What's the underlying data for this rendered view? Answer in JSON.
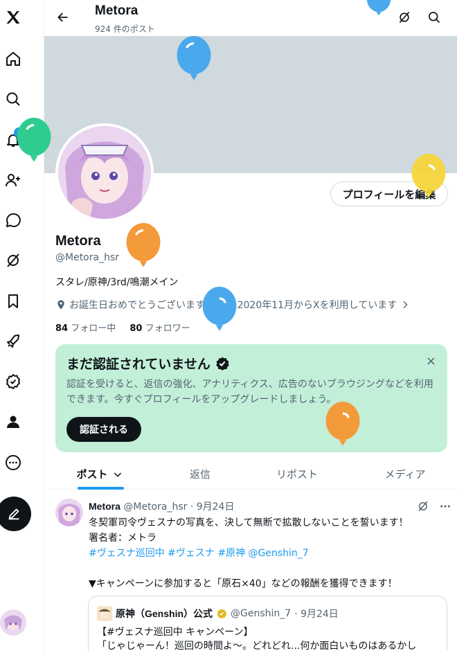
{
  "sidebar": {
    "notification_count": "1",
    "items": [
      {
        "name": "x-logo-icon"
      },
      {
        "name": "home-icon"
      },
      {
        "name": "search-icon"
      },
      {
        "name": "bell-icon"
      },
      {
        "name": "add-user-icon"
      },
      {
        "name": "messages-icon"
      },
      {
        "name": "grok-icon"
      },
      {
        "name": "bookmark-icon"
      },
      {
        "name": "rocket-icon"
      },
      {
        "name": "verified-icon"
      },
      {
        "name": "profile-icon"
      },
      {
        "name": "more-icon"
      }
    ]
  },
  "header": {
    "title": "Metora",
    "post_count": "924 件のポスト"
  },
  "profile": {
    "edit_label": "プロフィールを編集",
    "name": "Metora",
    "handle": "@Metora_hsr",
    "bio": "スタレ/原神/3rd/鳴潮メイン",
    "birthday": "お誕生日おめでとうございます。",
    "joined": "2020年11月からXを利用しています",
    "following_count": "84",
    "following_label": "フォロー中",
    "followers_count": "80",
    "followers_label": "フォロワー"
  },
  "verify_card": {
    "title": "まだ認証されていません",
    "body": "認証を受けると、返信の強化、アナリティクス、広告のないブラウジングなどを利用できます。今すぐプロフィールをアップグレードしましょう。",
    "button": "認証される",
    "close": "×"
  },
  "tabs": [
    {
      "label": "ポスト"
    },
    {
      "label": "返信"
    },
    {
      "label": "リポスト"
    },
    {
      "label": "メディア"
    }
  ],
  "post": {
    "author": "Metora",
    "handle": "@Metora_hsr",
    "date": "· 9月24日",
    "line1": "冬契軍司令ヴェスナの写真を、決して無断で拡散しないことを誓います！",
    "line2": "署名者：メトラ",
    "tags": "#ヴェスナ巡回中 #ヴェスナ #原神 @Genshin_7",
    "line3": "▼キャンペーンに参加すると「原石×40」などの報酬を獲得できます！",
    "quote": {
      "author": "原神（Genshin）公式",
      "handle": "@Genshin_7",
      "date": "· 9月24日",
      "line1": "【#ヴェスナ巡回中 キャンペーン】",
      "line2": "「じゃじゃーん！巡回の時間よ～。どれどれ...何か面白いものはあるかし"
    }
  },
  "colors": {
    "accent": "#1d9bf0",
    "banner": "#cfd9de",
    "verify_bg": "#c2efd8",
    "balloon_blue": "#4aa8ec",
    "balloon_green": "#2ecc8f",
    "balloon_orange": "#f39a3a",
    "balloon_yellow": "#f5d63c"
  }
}
